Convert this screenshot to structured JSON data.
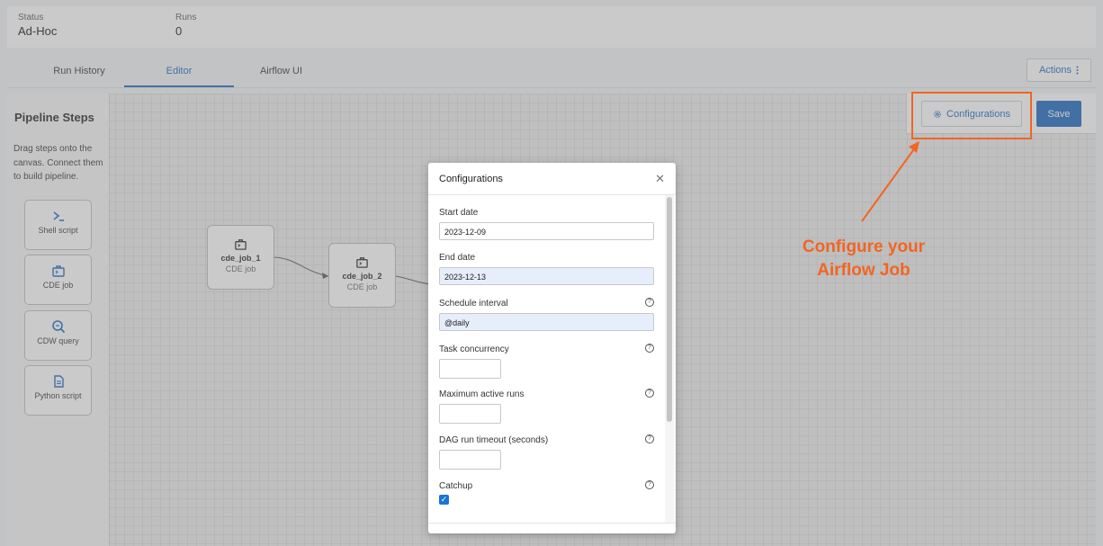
{
  "header": {
    "status_label": "Status",
    "status_value": "Ad-Hoc",
    "runs_label": "Runs",
    "runs_value": "0"
  },
  "tabs": [
    {
      "label": "Run History",
      "active": false
    },
    {
      "label": "Editor",
      "active": true
    },
    {
      "label": "Airflow UI",
      "active": false
    }
  ],
  "actions": {
    "label": "Actions",
    "icon": "more-vertical-icon"
  },
  "sidebar": {
    "title": "Pipeline Steps",
    "description": "Drag steps onto the canvas. Connect them to build pipeline.",
    "steps": [
      {
        "label": "Shell script",
        "icon": "terminal-icon"
      },
      {
        "label": "CDE job",
        "icon": "briefcase-icon"
      },
      {
        "label": "CDW query",
        "icon": "query-search-icon"
      },
      {
        "label": "Python script",
        "icon": "document-icon"
      }
    ]
  },
  "canvas": {
    "nodes": [
      {
        "name": "cde_job_1",
        "type": "CDE job",
        "icon": "briefcase-icon"
      },
      {
        "name": "cde_job_2",
        "type": "CDE job",
        "icon": "briefcase-icon"
      }
    ]
  },
  "toolbar": {
    "configurations_label": "Configurations",
    "configurations_icon": "gear-icon",
    "save_label": "Save"
  },
  "modal": {
    "title": "Configurations",
    "fields": {
      "start_date": {
        "label": "Start date",
        "value": "2023-12-09"
      },
      "end_date": {
        "label": "End date",
        "value": "2023-12-13"
      },
      "schedule_interval": {
        "label": "Schedule interval",
        "value": "@daily"
      },
      "task_concurrency": {
        "label": "Task concurrency",
        "value": ""
      },
      "max_active_runs": {
        "label": "Maximum active runs",
        "value": ""
      },
      "dag_run_timeout": {
        "label": "DAG run timeout (seconds)",
        "value": ""
      },
      "catchup": {
        "label": "Catchup",
        "checked": true
      }
    }
  },
  "annotation": {
    "text": "Configure your Airflow Job",
    "color": "#f26522"
  },
  "colors": {
    "accent": "#1565c0",
    "annotation": "#f26522"
  }
}
